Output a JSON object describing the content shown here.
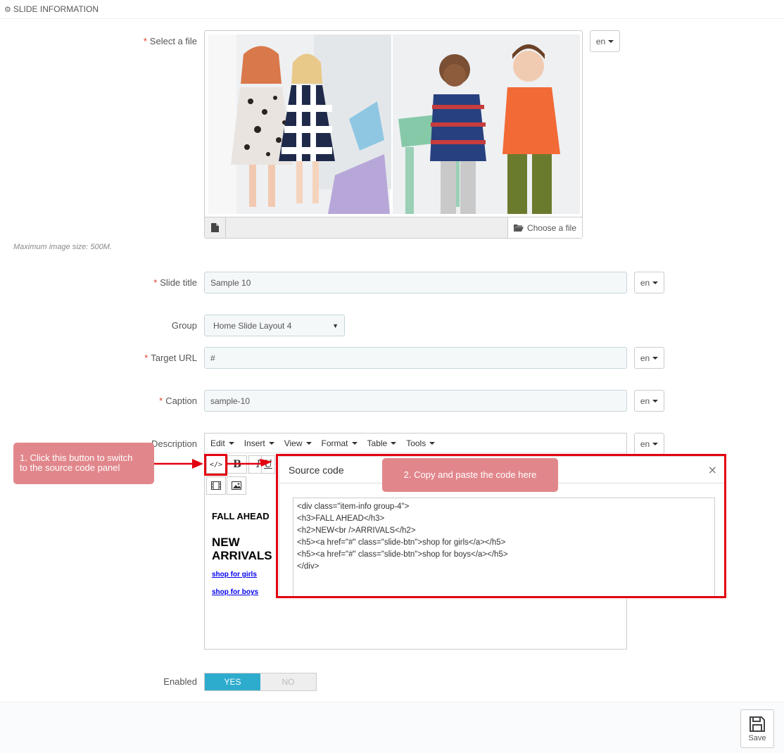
{
  "panel": {
    "title": "SLIDE INFORMATION"
  },
  "fields": {
    "file": {
      "label": "Select a file",
      "lang": "en",
      "choose_label": "Choose a file",
      "hint": "Maximum image size: 500M."
    },
    "slide_title": {
      "label": "Slide title",
      "value": "Sample 10",
      "lang": "en"
    },
    "group": {
      "label": "Group",
      "value": "Home Slide Layout 4"
    },
    "target_url": {
      "label": "Target URL",
      "value": "#",
      "lang": "en"
    },
    "caption": {
      "label": "Caption",
      "value": "sample-10",
      "lang": "en"
    },
    "description": {
      "label": "Description",
      "lang": "en"
    },
    "enabled": {
      "label": "Enabled",
      "yes": "YES",
      "no": "NO",
      "value": "YES"
    }
  },
  "editor": {
    "menus": [
      "Edit",
      "Insert",
      "View",
      "Format",
      "Table",
      "Tools"
    ],
    "toolbar": {
      "source_code": "</>",
      "bold": "B",
      "italic": "I",
      "underline": "U"
    },
    "content": {
      "h3": "FALL AHEAD",
      "h2_line1": "NEW",
      "h2_line2": "ARRIVALS",
      "link1": "shop for girls",
      "link2": "shop for boys"
    }
  },
  "source_dialog": {
    "title": "Source code",
    "close": "×",
    "code": "<div class=\"item-info group-4\">\n<h3>FALL AHEAD</h3>\n<h2>NEW<br />ARRIVALS</h2>\n<h5><a href=\"#\" class=\"slide-btn\">shop for girls</a></h5>\n<h5><a href=\"#\" class=\"slide-btn\">shop for boys</a></h5>\n</div>"
  },
  "callouts": {
    "step1_line1": "1. Click this button to switch",
    "step1_line2": "to the source code panel",
    "step2": "2. Copy and paste the code here"
  },
  "footer": {
    "save_label": "Save"
  },
  "colors": {
    "accent": "#2eacce",
    "required": "#e3402d",
    "annotation_red": "#e3000f",
    "callout_bg": "#e1878c"
  }
}
